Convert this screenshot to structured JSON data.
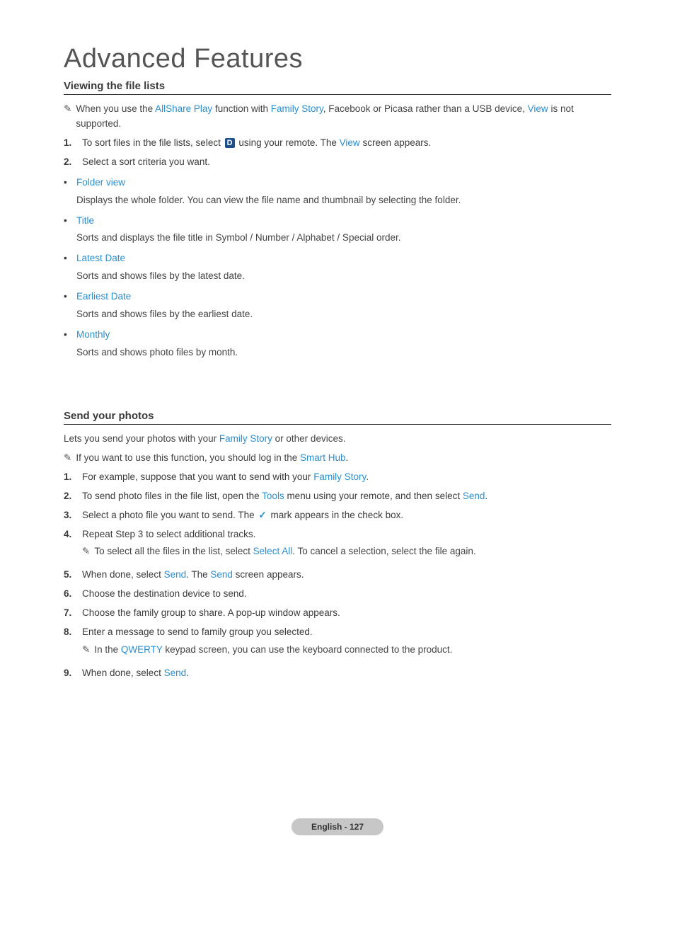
{
  "page_title": "Advanced Features",
  "section1": {
    "heading": "Viewing the file lists",
    "note_parts": {
      "p1": "When you use the ",
      "kw1": "AllShare Play",
      "p2": " function with ",
      "kw2": "Family Story",
      "p3": ", Facebook or Picasa rather than a USB device, ",
      "kw3": "View",
      "p4": " is not supported."
    },
    "step1_parts": {
      "num": "1.",
      "p1": "To sort files in the file lists, select ",
      "d": "D",
      "p2": " using your remote. The ",
      "kw1": "View",
      "p3": " screen appears."
    },
    "step2": {
      "num": "2.",
      "text": "Select a sort criteria you want."
    },
    "bullets": [
      {
        "label": "Folder view",
        "desc": "Displays the whole folder. You can view the file name and thumbnail by selecting the folder."
      },
      {
        "label": "Title",
        "desc": "Sorts and displays the file title in Symbol / Number / Alphabet / Special order."
      },
      {
        "label": "Latest Date",
        "desc": "Sorts and shows files by the latest date."
      },
      {
        "label": "Earliest Date",
        "desc": "Sorts and shows files by the earliest date."
      },
      {
        "label": "Monthly",
        "desc": "Sorts and shows photo files by month."
      }
    ]
  },
  "section2": {
    "heading": "Send your photos",
    "intro": {
      "p1": "Lets you send your photos with your ",
      "kw1": "Family Story",
      "p2": " or other devices."
    },
    "note": {
      "p1": "If you want to use this function, you should log in the ",
      "kw1": "Smart Hub",
      "p2": "."
    },
    "steps": {
      "s1": {
        "num": "1.",
        "p1": "For example, suppose that you want to send with your ",
        "kw1": "Family Story",
        "p2": "."
      },
      "s2": {
        "num": "2.",
        "p1": "To send photo files in the file list, open the ",
        "kw1": "Tools",
        "p2": " menu using your remote, and then select ",
        "kw2": "Send",
        "p3": "."
      },
      "s3": {
        "num": "3.",
        "p1": "Select a photo file you want to send. The ",
        "p2": " mark appears in the check box."
      },
      "s4": {
        "num": "4.",
        "text": "Repeat Step 3 to select additional tracks."
      },
      "s4_note": {
        "p1": "To select all the files in the list, select ",
        "kw1": "Select All",
        "p2": ". To cancel a selection, select the file again."
      },
      "s5": {
        "num": "5.",
        "p1": "When done, select ",
        "kw1": "Send",
        "p2": ". The ",
        "kw2": "Send",
        "p3": " screen appears."
      },
      "s6": {
        "num": "6.",
        "text": "Choose the destination device to send."
      },
      "s7": {
        "num": "7.",
        "text": "Choose the family group to share. A pop-up window appears."
      },
      "s8": {
        "num": "8.",
        "text": "Enter a message to send to family group you selected."
      },
      "s8_note": {
        "p1": "In the ",
        "kw1": "QWERTY",
        "p2": " keypad screen, you can use the keyboard connected to the product."
      },
      "s9": {
        "num": "9.",
        "p1": "When done, select ",
        "kw1": "Send",
        "p2": "."
      }
    }
  },
  "footer": "English - 127"
}
